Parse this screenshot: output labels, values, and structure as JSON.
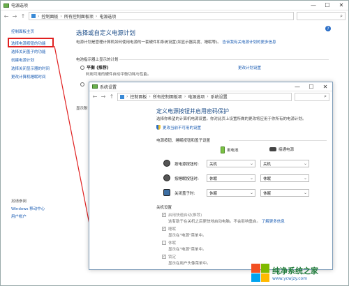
{
  "win1": {
    "title": "电源选项",
    "controls": {
      "minimize": "—",
      "maximize": "☐",
      "close": "✕"
    },
    "breadcrumb": [
      "控制面板",
      "所有控制面板项",
      "电源选项"
    ],
    "help": "?"
  },
  "sidebar": {
    "items": [
      {
        "label": "控制面板主页"
      },
      {
        "label": "选择电源按钮的功能"
      },
      {
        "label": "选择关闭盖子的功能"
      },
      {
        "label": "创建电源计划"
      },
      {
        "label": "选择关闭显示器的时间"
      },
      {
        "label": "更改计算机睡眠时间"
      }
    ],
    "see_also": "另请参阅",
    "bottom": [
      {
        "label": "Windows 移动中心"
      },
      {
        "label": "用户帐户"
      }
    ]
  },
  "main1": {
    "heading": "选择或自定义电源计划",
    "desc": "电源计划是管理计算机如何使用电源的一套硬件和系统设置(如显示器亮度、睡眠等)。",
    "desc_link": "告诉我有关电源计划的更多信息",
    "plan_header": "电池指示器上显示的计划",
    "plan_name": "平衡 (推荐)",
    "plan_desc": "利用可用的硬件自动平衡功耗与性能。",
    "plan_link": "更改计划设置",
    "fragment": "显示附"
  },
  "win2": {
    "title": "系统设置",
    "controls": {
      "minimize": "—",
      "maximize": "☐",
      "close": "✕"
    },
    "breadcrumb": [
      "控制面板",
      "所有控制面板项",
      "电源选项",
      "系统设置"
    ],
    "heading": "定义电源按钮并启用密码保护",
    "desc": "选择你希望的计算机电源设置。你对此页上设置所做的更改将应用于你所有的电源计划。",
    "shield_link": "更改当前不可用的设置",
    "section1": "电源按钮、睡眠按钮和盖子设置",
    "col_battery": "用电池",
    "col_plugged": "接通电源",
    "rows": [
      {
        "label": "按电源按钮时:",
        "battery": "关机",
        "plugged": "关机"
      },
      {
        "label": "按睡眠按钮时:",
        "battery": "休眠",
        "plugged": "休眠"
      },
      {
        "label": "关闭盖子时:",
        "battery": "休眠",
        "plugged": "休眠"
      }
    ],
    "section2": "关机设置",
    "options": [
      {
        "label": "启用快速启动(推荐)",
        "desc": "这有助于在关机之后更快地启动电脑。不会影响重启。",
        "link": "了解更多信息",
        "checked": true
      },
      {
        "label": "睡眠",
        "desc": "显示在\"电源\"菜单中。",
        "checked": true
      },
      {
        "label": "休眠",
        "desc": "显示在\"电源\"菜单中。",
        "checked": false
      },
      {
        "label": "锁定",
        "desc": "显示在用户头像菜单中。",
        "checked": true
      }
    ]
  },
  "watermark": {
    "title": "纯净系统之家",
    "url": "www.ycwjzy.com"
  },
  "colors": {
    "link": "#1a5cb3",
    "heading": "#1d4e89",
    "highlight": "#e02020",
    "brand_green": "#1f7a3a"
  }
}
